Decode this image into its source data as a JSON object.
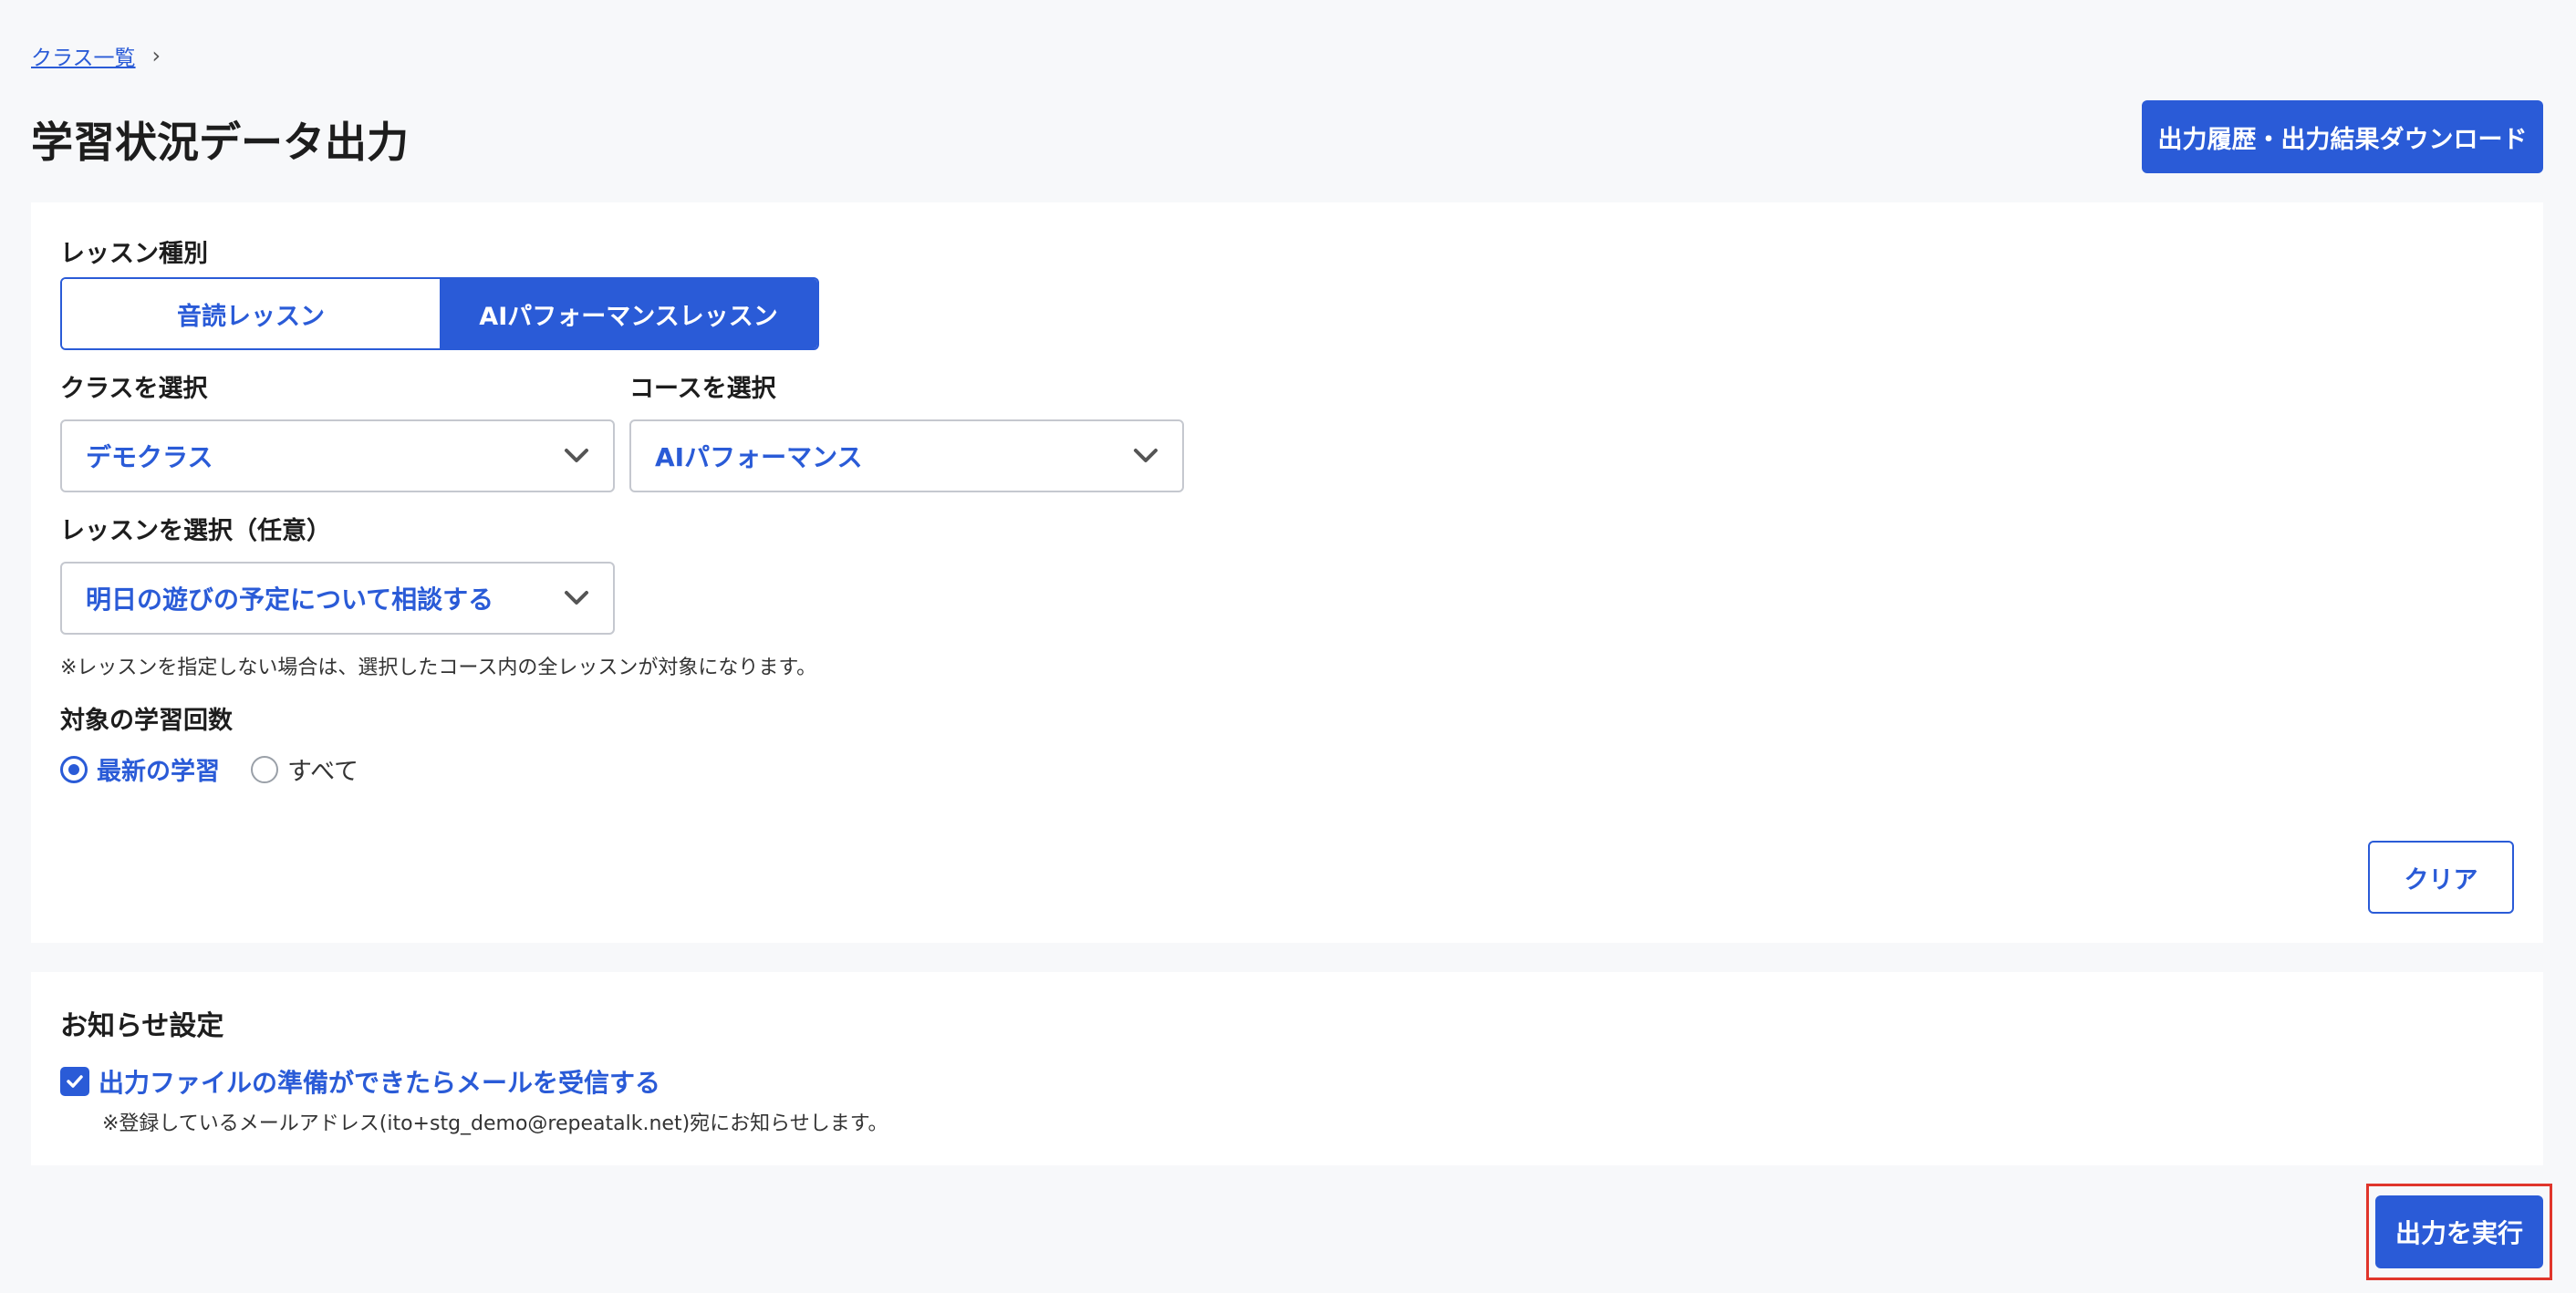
{
  "breadcrumb": {
    "link_label": "クラス一覧",
    "separator": "›"
  },
  "page_title": "学習状況データ出力",
  "header": {
    "history_button_label": "出力履歴・出力結果ダウンロード"
  },
  "form": {
    "lesson_type_label": "レッスン種別",
    "lesson_types": [
      {
        "label": "音読レッスン",
        "selected": false
      },
      {
        "label": "AIパフォーマンスレッスン",
        "selected": true
      }
    ],
    "class_select": {
      "label": "クラスを選択",
      "value": "デモクラス"
    },
    "course_select": {
      "label": "コースを選択",
      "value": "AIパフォーマンス"
    },
    "lesson_select": {
      "label": "レッスンを選択（任意）",
      "value": "明日の遊びの予定について相談する"
    },
    "lesson_note": "※レッスンを指定しない場合は、選択したコース内の全レッスンが対象になります。",
    "attempts_label": "対象の学習回数",
    "attempt_options": [
      {
        "label": "最新の学習",
        "selected": true
      },
      {
        "label": "すべて",
        "selected": false
      }
    ],
    "clear_button_label": "クリア"
  },
  "notice": {
    "title": "お知らせ設定",
    "checkbox_label": "出力ファイルの準備ができたらメールを受信する",
    "checked": true,
    "note": "※登録しているメールアドレス(ito+stg_demo@repeatalk.net)宛にお知らせします。"
  },
  "execute_button_label": "出力を実行",
  "colors": {
    "accent": "#2a5bd7",
    "highlight": "#e0352b",
    "background": "#f7f8fa"
  },
  "icons": [
    "chevron-right-icon",
    "chevron-down-icon",
    "check-icon"
  ]
}
